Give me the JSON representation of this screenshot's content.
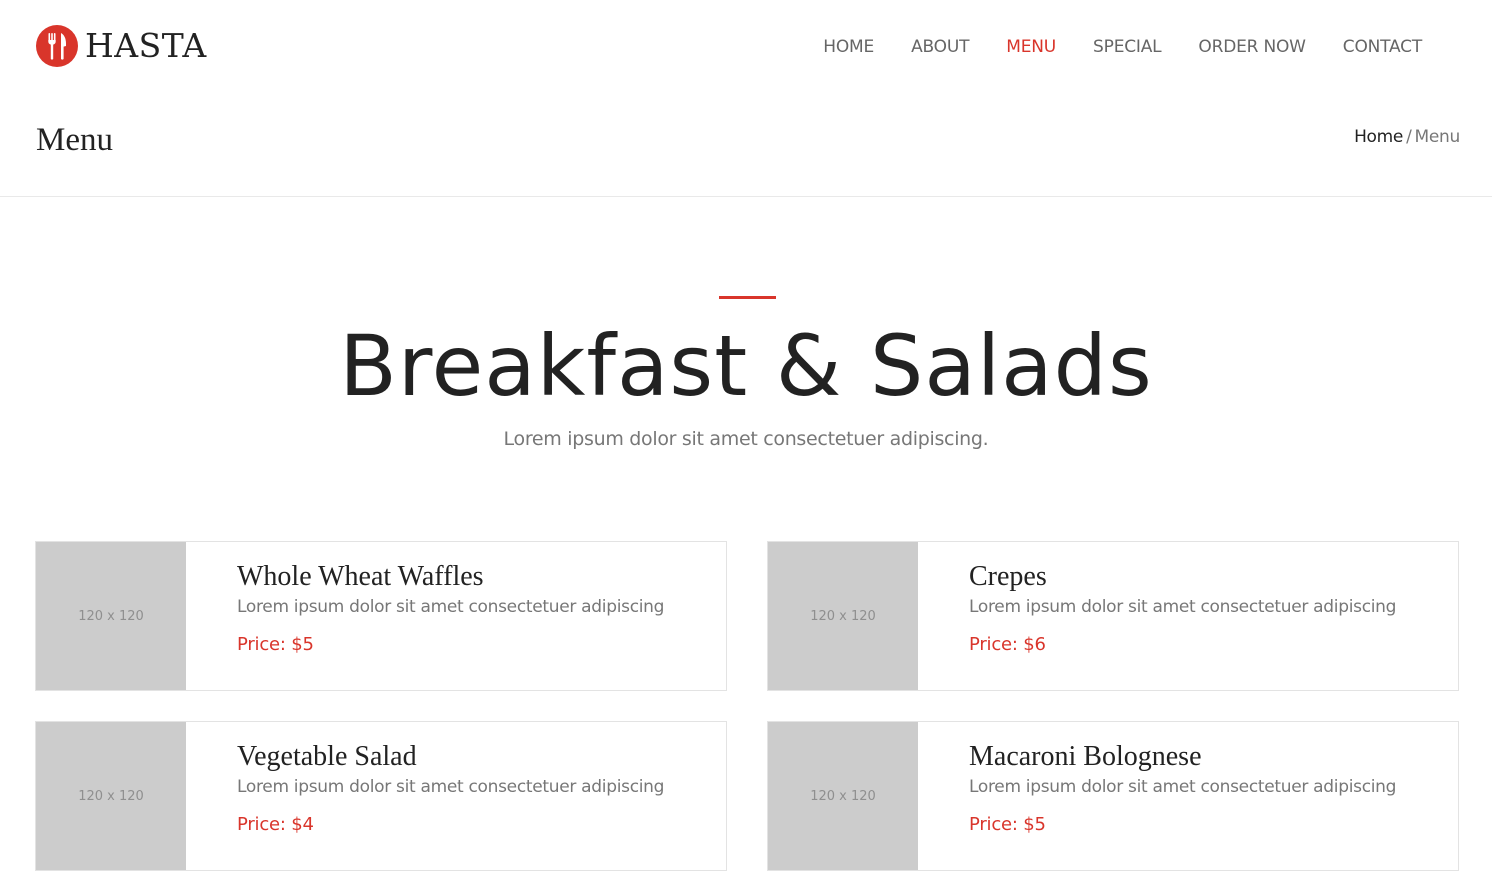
{
  "brand": {
    "name": "HASTA",
    "accent_color": "#d9352b",
    "logo_icon": "fork-knife-icon"
  },
  "nav": {
    "items": [
      {
        "label": "HOME",
        "active": false
      },
      {
        "label": "ABOUT",
        "active": false
      },
      {
        "label": "MENU",
        "active": true
      },
      {
        "label": "SPECIAL",
        "active": false
      },
      {
        "label": "ORDER NOW",
        "active": false
      },
      {
        "label": "CONTACT",
        "active": false
      }
    ]
  },
  "page": {
    "title": "Menu",
    "breadcrumb": {
      "home": "Home",
      "separator": "/",
      "current": "Menu"
    }
  },
  "section": {
    "title": "Breakfast & Salads",
    "subtitle": "Lorem ipsum dolor sit amet consectetuer adipiscing."
  },
  "menu_items": [
    {
      "name": "Whole Wheat Waffles",
      "description": "Lorem ipsum dolor sit amet consectetuer adipiscing",
      "price": "Price: $5",
      "image_placeholder": "120 x 120"
    },
    {
      "name": "Crepes",
      "description": "Lorem ipsum dolor sit amet consectetuer adipiscing",
      "price": "Price: $6",
      "image_placeholder": "120 x 120"
    },
    {
      "name": "Vegetable Salad",
      "description": "Lorem ipsum dolor sit amet consectetuer adipiscing",
      "price": "Price: $4",
      "image_placeholder": "120 x 120"
    },
    {
      "name": "Macaroni Bolognese",
      "description": "Lorem ipsum dolor sit amet consectetuer adipiscing",
      "price": "Price: $5",
      "image_placeholder": "120 x 120"
    }
  ]
}
